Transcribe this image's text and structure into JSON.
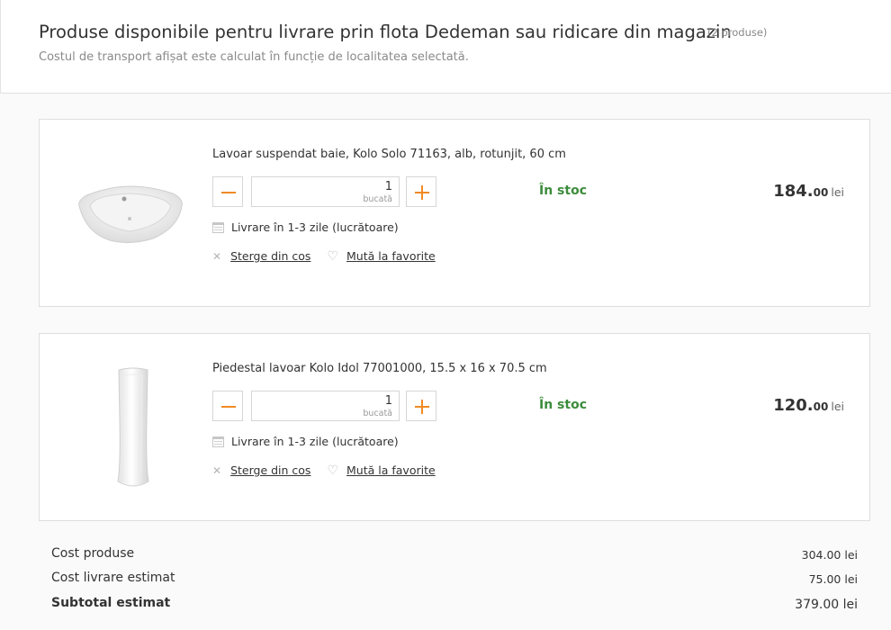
{
  "header": {
    "title": "Produse disponibile pentru livrare prin flota Dedeman sau ridicare din magazin",
    "count": "(2 produse)",
    "subtitle": "Costul de transport afișat este calculat în funcție de localitatea selectată."
  },
  "products": [
    {
      "name": "Lavoar suspendat baie, Kolo Solo 71163, alb, rotunjit, 60 cm",
      "quantity": "1",
      "unit": "bucată",
      "stock": "În stoc",
      "price_int": "184.",
      "price_dec": "00",
      "currency": "lei",
      "delivery": "Livrare în 1-3 zile (lucrătoare)",
      "remove_label": "Sterge din cos",
      "favorite_label": "Mută la favorite",
      "image_icon": "washbasin-image"
    },
    {
      "name": "Piedestal lavoar Kolo Idol 77001000, 15.5 x 16 x 70.5 cm",
      "quantity": "1",
      "unit": "bucată",
      "stock": "În stoc",
      "price_int": "120.",
      "price_dec": "00",
      "currency": "lei",
      "delivery": "Livrare în 1-3 zile (lucrătoare)",
      "remove_label": "Sterge din cos",
      "favorite_label": "Mută la favorite",
      "image_icon": "pedestal-image"
    }
  ],
  "totals": {
    "products_label": "Cost produse",
    "products_value": "304.00 lei",
    "delivery_label": "Cost livrare estimat",
    "delivery_value": "75.00 lei",
    "subtotal_label": "Subtotal estimat",
    "subtotal_value": "379.00 lei"
  },
  "colors": {
    "accent": "#f08a24",
    "stock": "#3c8c3c"
  }
}
